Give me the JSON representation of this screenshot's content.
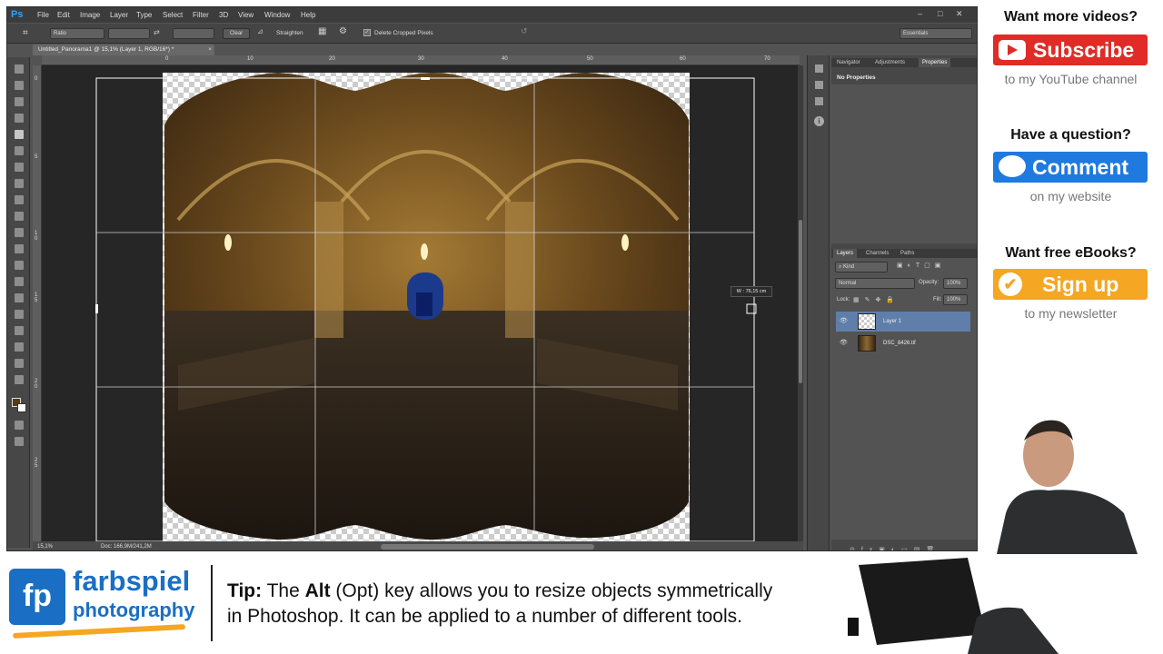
{
  "app": {
    "logo": "Ps",
    "menu": [
      "File",
      "Edit",
      "Image",
      "Layer",
      "Type",
      "Select",
      "Filter",
      "3D",
      "View",
      "Window",
      "Help"
    ],
    "window_controls": [
      "–",
      "□",
      "✕"
    ]
  },
  "options_bar": {
    "ratio_value": "Ratio",
    "clear_label": "Clear",
    "straighten_label": "Straighten",
    "delete_cropped_label": "Delete Cropped Pixels",
    "workspace_value": "Essentials"
  },
  "document": {
    "tab_title": "Untitled_Panorama1 @ 15,1% (Layer 1, RGB/16*) *",
    "tab_close": "×",
    "width_readout": "W :  76,15 cm"
  },
  "rulers": {
    "horizontal": [
      "0",
      "10",
      "20",
      "30",
      "40",
      "50",
      "60",
      "70"
    ],
    "vertical": [
      "0",
      "5",
      "1 0",
      "1 5",
      "2 0",
      "2 5"
    ]
  },
  "status": {
    "zoom": "15,1%",
    "doc_size": "Doc: 166,9M/241,2M"
  },
  "panels": {
    "top_tabs": [
      "Navigator",
      "Adjustments",
      "Properties"
    ],
    "properties_text": "No Properties",
    "layer_tabs": [
      "Layers",
      "Channels",
      "Paths"
    ],
    "kind_value": "Kind",
    "blend_mode": "Normal",
    "opacity_label": "Opacity:",
    "opacity_value": "100%",
    "lock_label": "Lock:",
    "fill_label": "Fill:",
    "fill_value": "100%",
    "layers": [
      {
        "name": "Layer 1"
      },
      {
        "name": "DSC_8426.tif"
      }
    ]
  },
  "promo": {
    "videos_heading": "Want more videos?",
    "subscribe_label": "Subscribe",
    "subscribe_sub": "to my YouTube channel",
    "question_heading": "Have a question?",
    "comment_label": "Comment",
    "comment_sub": "on my website",
    "ebooks_heading": "Want free eBooks?",
    "signup_label": "Sign up",
    "signup_sub": "to my newsletter"
  },
  "brand": {
    "fp": "fp",
    "line1": "farbspiel",
    "line2": "photography"
  },
  "tip": {
    "label": "Tip:",
    "t1": " The ",
    "key": "Alt",
    "t2": " (Opt) key allows you to resize objects symmetrically",
    "line2": "in Photoshop. It can be applied to a number of different tools."
  },
  "colors": {
    "youtube_red": "#e02b27",
    "comment_blue": "#1f7ae0",
    "signup_orange": "#f5a623",
    "brand_blue": "#1a6fc4",
    "layer_selected": "#5f7faa"
  }
}
